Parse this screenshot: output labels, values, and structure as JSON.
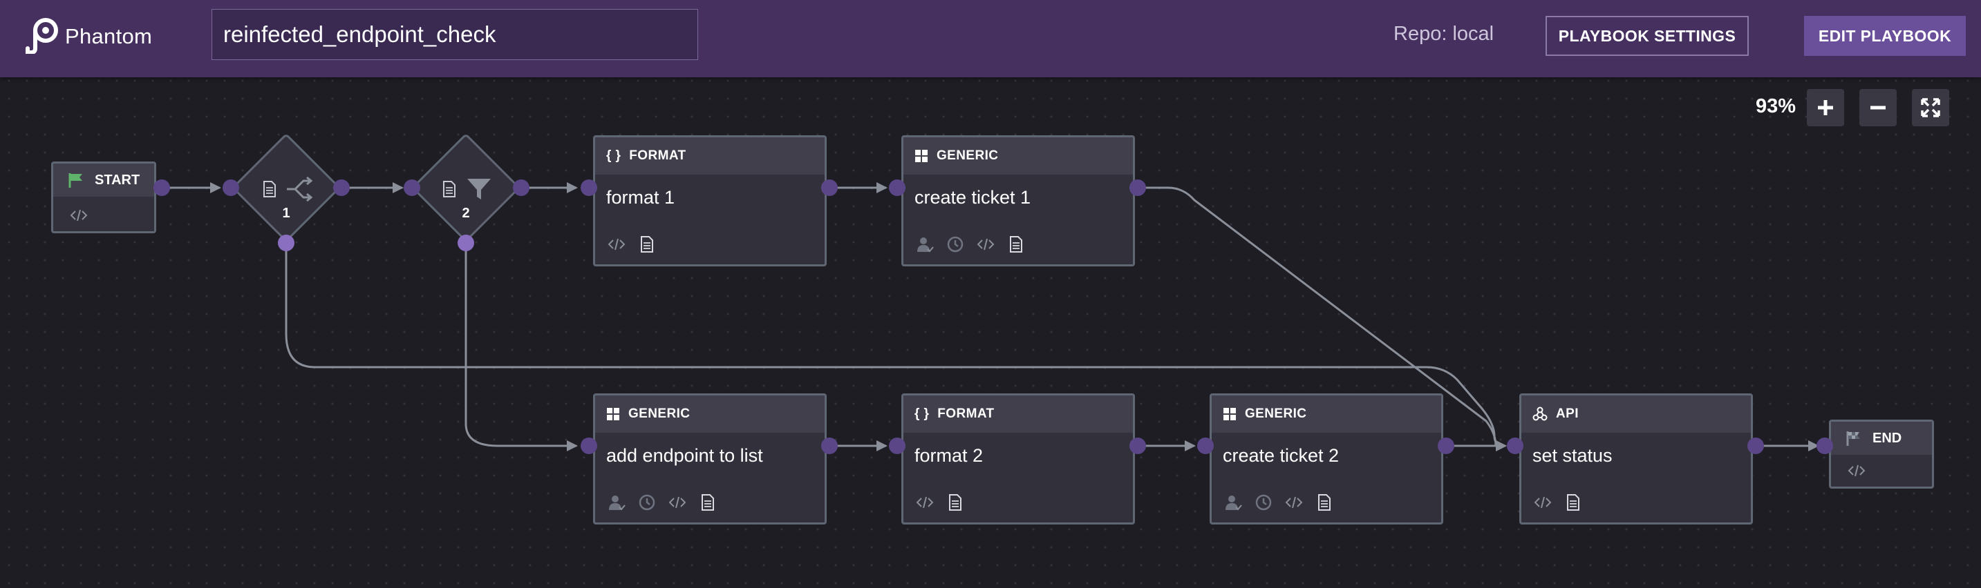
{
  "app": {
    "logo_text": "Phantom",
    "logo_icon": "phantom-logo-icon"
  },
  "header": {
    "playbook_name": "reinfected_endpoint_check",
    "repo_label": "Repo: local",
    "settings_button": "PLAYBOOK SETTINGS",
    "edit_button": "EDIT PLAYBOOK"
  },
  "zoom": {
    "level": "93%",
    "zoom_in_icon": "plus-icon",
    "zoom_out_icon": "minus-icon",
    "fit_icon": "expand-icon"
  },
  "colors": {
    "topbar": "#45305f",
    "canvas": "#1e1d24",
    "node_bg": "#32313b",
    "node_header": "#403f4b",
    "node_border": "#5f6674",
    "port": "#5b4788",
    "port_bottom": "#8a6fc0",
    "wire": "#8a8f99",
    "start_flag": "#5fb36a",
    "edit_button": "#6a4f9a"
  },
  "nodes": {
    "start": {
      "label": "START",
      "icon": "flag-icon",
      "foot_icon": "code-icon"
    },
    "end": {
      "label": "END",
      "icon": "checkered-flag-icon",
      "foot_icon": "code-icon"
    },
    "decision1": {
      "number": "1",
      "icons": [
        "document-icon",
        "branch-icon"
      ]
    },
    "filter2": {
      "number": "2",
      "icons": [
        "document-icon",
        "filter-icon"
      ]
    },
    "format1": {
      "type": "FORMAT",
      "type_icon": "braces-icon",
      "name": "format 1",
      "icons": [
        "code-icon",
        "document-icon"
      ]
    },
    "ticket1": {
      "type": "GENERIC",
      "type_icon": "grid-icon",
      "name": "create ticket 1",
      "icons": [
        "user-check-icon",
        "clock-icon",
        "code-icon",
        "document-icon"
      ]
    },
    "endpoint": {
      "type": "GENERIC",
      "type_icon": "grid-icon",
      "name": "add endpoint to list",
      "icons": [
        "user-check-icon",
        "clock-icon",
        "code-icon",
        "document-icon"
      ]
    },
    "format2": {
      "type": "FORMAT",
      "type_icon": "braces-icon",
      "name": "format 2",
      "icons": [
        "code-icon",
        "document-icon"
      ]
    },
    "ticket2": {
      "type": "GENERIC",
      "type_icon": "grid-icon",
      "name": "create ticket 2",
      "icons": [
        "user-check-icon",
        "clock-icon",
        "code-icon",
        "document-icon"
      ]
    },
    "status": {
      "type": "API",
      "type_icon": "api-icon",
      "name": "set status",
      "icons": [
        "code-icon",
        "document-icon"
      ]
    }
  }
}
